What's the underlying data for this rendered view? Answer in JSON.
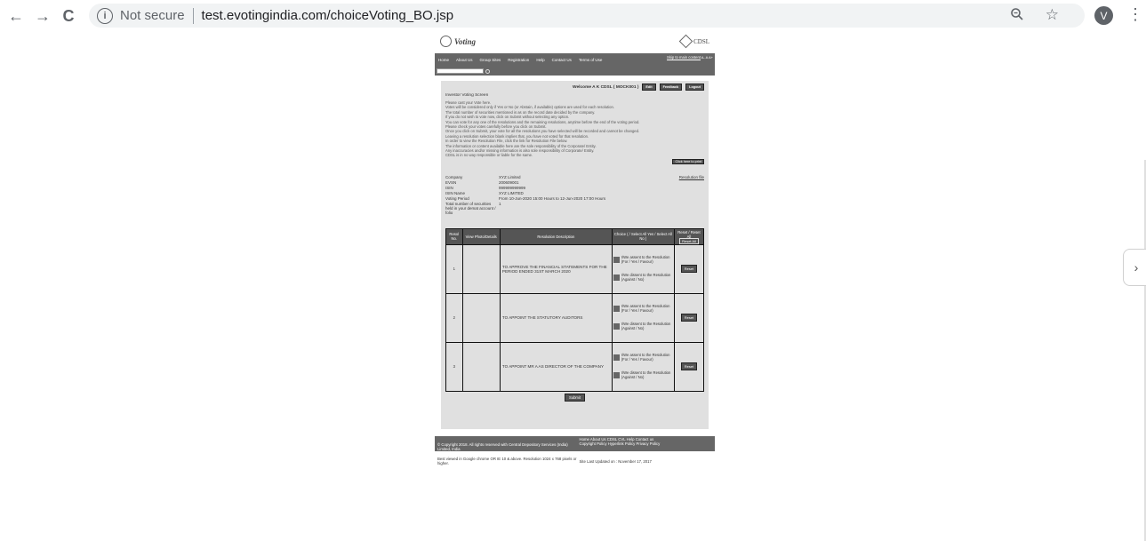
{
  "browser": {
    "back": "←",
    "forward": "→",
    "reload": "C",
    "info": "i",
    "not_secure": "Not secure",
    "url": "test.evotingindia.com/choiceVoting_BO.jsp",
    "avatar": "V",
    "zoom_icon": "zoom-icon",
    "side_chevron": "›"
  },
  "site": {
    "logo_text": "Voting",
    "cdsl_text": "CDSL",
    "nav": [
      "Home",
      "About Us",
      "Group Sites",
      "Registration",
      "Help",
      "Contact Us",
      "Terms of Use"
    ],
    "skip_link": "Skip to main content",
    "font_controls": "A- A A+",
    "welcome": "Welcome A K CDSL ( MOCK001 )",
    "buttons": {
      "b1": "Edit",
      "b2": "Feedback",
      "b3": "Logout"
    },
    "screen_title": "Investor Voting Screen",
    "instructions": [
      "Please cast your Vote here.",
      "Votes will be considered only if Yes or No (or Abstain, if available) options are used for each resolution.",
      "The total number of securities mentioned is as on the record date decided by the company.",
      "If you do not wish to vote now, click on Submit without selecting any option.",
      "You can vote for any one of the resolutions and the remaining resolutions, anytime before the end of the voting period.",
      "Please check your votes carefully before you click on Submit.",
      "Once you click on Submit, your vote for all the resolutions you have selected will be recorded and cannot be changed.",
      "Leaving a resolution selection blank implies that, you have not voted for that resolution.",
      "In order to view the Resolution File, click the link for Resolution File below.",
      "The information or content available here are the sole responsibility of the Corporate/ Entity.",
      "Any inaccuracies and/or missing information is also sole responsibility of Corporate/ Entity.",
      "CDSL is in no way responsible or liable for the same."
    ],
    "click_here": "Click here to print",
    "details": {
      "company_label": "Company",
      "company": "XYZ Limited",
      "evsn_label": "EVSN",
      "evsn": "200609001",
      "isin_label": "ISIN",
      "isin": "999999999999",
      "isin_name_label": "ISIN Name",
      "isin_name": "XYZ LIMITED",
      "period_label": "Voting Period",
      "period": "From 10-Jun-2020 15:00 Hours to 12-Jun-2020 17:00 Hours",
      "securities_label": "Total number of securities held in your demat account / folio",
      "securities": "1",
      "resolution_file": "Resolution file"
    },
    "table": {
      "headers": {
        "sno": "Resol No.",
        "photo": "View Photo/Details",
        "desc": "Resolution Description",
        "choice": "Choice ( / Select All Yes / Select All No )",
        "reset": "Reset / Reset All",
        "reset_all": "Reset All"
      },
      "rows": [
        {
          "no": "1",
          "desc": "TO APPROVE THE FINANCIAL STATEMENTS FOR THE PERIOD ENDED 31ST MARCH 2020",
          "assent": "I/We assent to the Resolution (For / Yes / Favour)",
          "dissent": "I/We dissent to the Resolution (Against / No)",
          "reset": "Reset"
        },
        {
          "no": "2",
          "desc": "TO APPOINT THE STATUTORY AUDITORS",
          "assent": "I/We assent to the Resolution (For / Yes / Favour)",
          "dissent": "I/We dissent to the Resolution (Against / No)",
          "reset": "Reset"
        },
        {
          "no": "3",
          "desc": "TO APPOINT MR A AS DIRECTOR OF THE COMPANY",
          "assent": "I/We assent to the Resolution (For / Yes / Favour)",
          "dissent": "I/We dissent to the Resolution (Against / No)",
          "reset": "Reset"
        }
      ]
    },
    "submit": "Submit",
    "footer": {
      "copyright": "© Copyright 2018. All rights reserved with Central Depository Services (India) Limited, India",
      "links1": "Home  About Us  CDSL  CVL  Help  Contact us",
      "links2": "Copyright Policy  Hyperlink Policy  Privacy Policy",
      "best_viewed": "Best viewed in Google chrome OR IE 10 & above. Resolution 1024 x 768 pixels or higher.",
      "updated": "Site Last Updated on : November 17, 2017"
    }
  }
}
